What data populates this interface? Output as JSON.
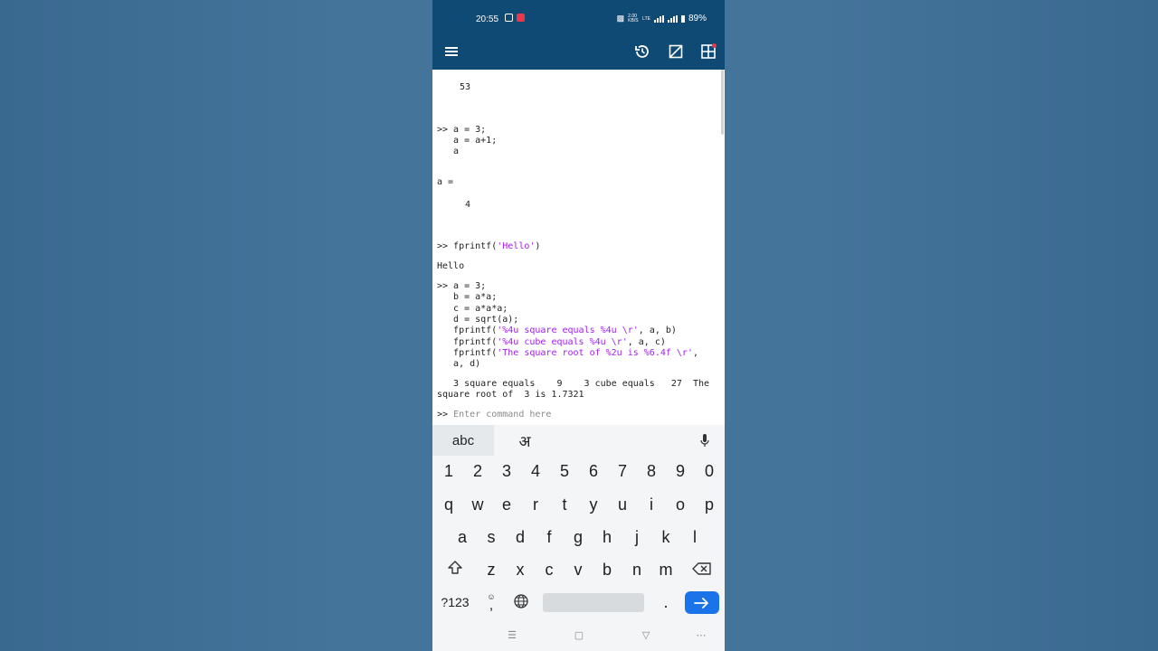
{
  "status": {
    "time": "20:55",
    "battery": "89%",
    "net": "2.00 KB/S",
    "lte": "LTE"
  },
  "appbar": {
    "icons": [
      "menu-icon",
      "history-icon",
      "clear-icon",
      "layout-icon"
    ],
    "accent": "#0e4a73"
  },
  "console": {
    "lines": [
      "53",
      ">> a = 3;",
      "   a = a+1;",
      "   a",
      "a =",
      "4",
      ">> fprintf('Hello')",
      "Hello",
      ">> a = 3;",
      "   b = a*a;",
      "   c = a*a*a;",
      "   d = sqrt(a);",
      "   fprintf('%4u square equals %4u \\r', a, b)",
      "   fprintf('%4u cube equals %4u \\r', a, c)",
      "   fprintf('The square root of %2u is %6.4f \\r',",
      "   a, d)",
      "   3 square equals    9    3 cube equals   27  The",
      "square root of  3 is 1.7321"
    ],
    "prompt": ">>",
    "input_placeholder": "Enter command here",
    "string_color": "#a020f0"
  },
  "keyboard": {
    "tab_abc": "abc",
    "tab_hindi": "अ",
    "row_numbers": [
      "1",
      "2",
      "3",
      "4",
      "5",
      "6",
      "7",
      "8",
      "9",
      "0"
    ],
    "row1": [
      "q",
      "w",
      "e",
      "r",
      "t",
      "y",
      "u",
      "i",
      "o",
      "p"
    ],
    "row2": [
      "a",
      "s",
      "d",
      "f",
      "g",
      "h",
      "j",
      "k",
      "l"
    ],
    "row3": [
      "z",
      "x",
      "c",
      "v",
      "b",
      "n",
      "m"
    ],
    "symbols_key": "?123",
    "comma_key": ",",
    "period_key": ".",
    "enter_color": "#1a73e8"
  }
}
